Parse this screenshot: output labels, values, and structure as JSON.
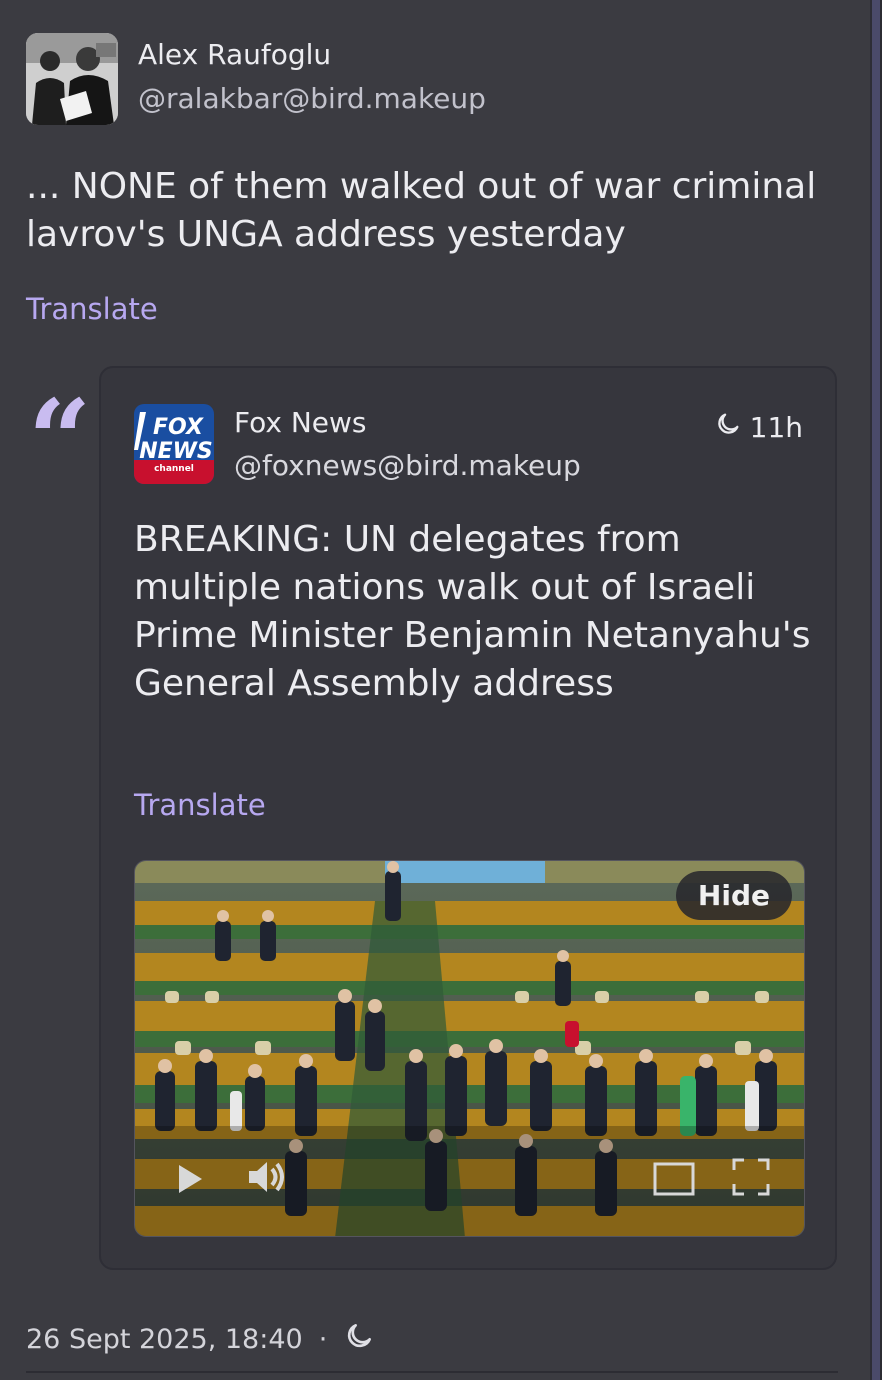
{
  "post": {
    "author_name": "Alex Raufoglu",
    "author_handle": "@ralakbar@bird.makeup",
    "text": "... NONE of them walked out of war criminal lavrov's UNGA address yesterday",
    "translate_label": "Translate",
    "timestamp": "26 Sept 2025, 18:40",
    "separator": "·",
    "visibility_icon": "moon-icon"
  },
  "quote": {
    "author_name": "Fox News",
    "author_handle": "@foxnews@bird.makeup",
    "time_ago": "11h",
    "time_icon": "moon-icon",
    "text": "BREAKING: UN delegates from multiple nations walk out of Israeli Prime Minister Benjamin Netanyahu's General Assembly address",
    "translate_label": "Translate",
    "logo_text_top": "FOX",
    "logo_text_bottom": "NEWS",
    "logo_text_sub": "channel"
  },
  "video": {
    "hide_label": "Hide",
    "controls": [
      "play-icon",
      "volume-icon",
      "pip-icon",
      "fullscreen-icon"
    ]
  },
  "colors": {
    "accent": "#b7a8f0",
    "background": "#3b3b41",
    "card": "#36363d"
  }
}
